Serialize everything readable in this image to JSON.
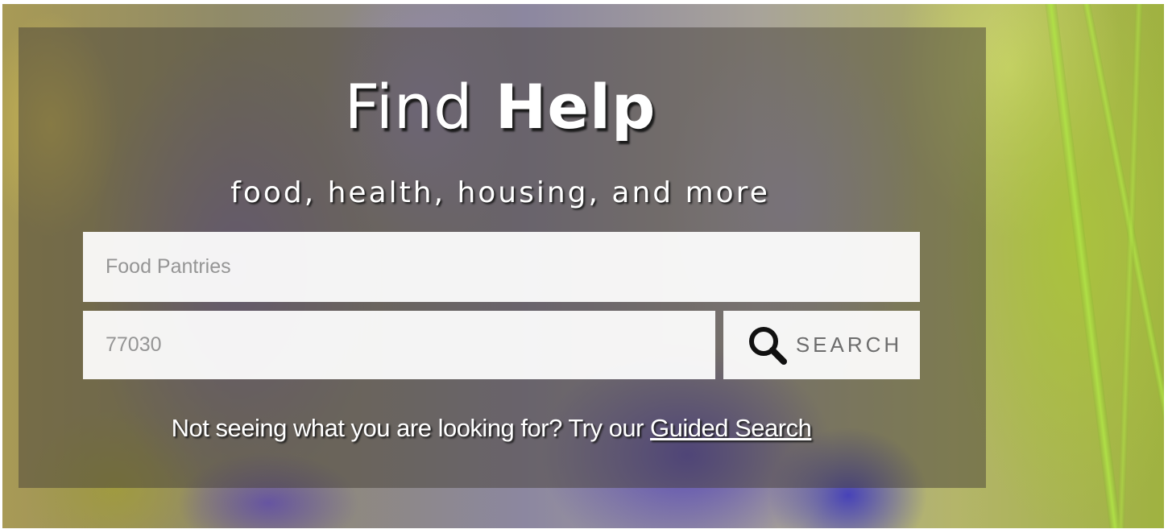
{
  "hero": {
    "title_part1": "Find",
    "title_part2": "Help",
    "subtitle": "food, health, housing, and more"
  },
  "search": {
    "service_placeholder": "Food Pantries",
    "location_placeholder": "77030",
    "button_label": "SEARCH",
    "button_icon": "search-icon"
  },
  "helper": {
    "text": "Not seeing what you are looking for? Try our ",
    "link_label": "Guided Search"
  },
  "colors": {
    "overlay": "#46403880",
    "field_background": "#ffffff",
    "text": "#ffffff"
  }
}
